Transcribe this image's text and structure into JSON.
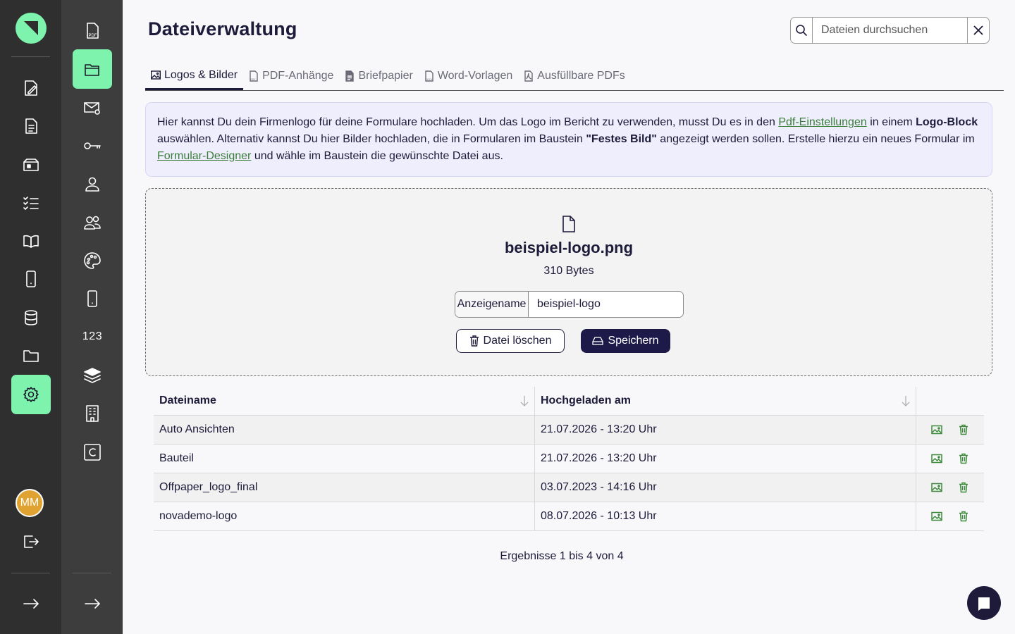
{
  "sidebar_primary": {
    "logo": "app-logo",
    "items": [
      {
        "name": "form-edit",
        "icon": "form-edit-icon"
      },
      {
        "name": "document",
        "icon": "document-icon"
      },
      {
        "name": "inbox",
        "icon": "inbox-icon"
      },
      {
        "name": "checklist",
        "icon": "checklist-icon"
      },
      {
        "name": "book",
        "icon": "book-icon"
      },
      {
        "name": "mobile",
        "icon": "mobile-icon"
      },
      {
        "name": "database",
        "icon": "database-icon"
      },
      {
        "name": "folder",
        "icon": "folder-icon"
      },
      {
        "name": "settings",
        "icon": "gear-icon",
        "active": true
      }
    ],
    "avatar_initials": "MM",
    "logout": "logout-icon",
    "expand": "arrow-right-icon"
  },
  "sidebar_secondary": {
    "items": [
      {
        "name": "pdf",
        "icon": "pdf-file-icon"
      },
      {
        "name": "files",
        "icon": "folder-open-icon",
        "active": true
      },
      {
        "name": "mail",
        "icon": "mail-at-icon"
      },
      {
        "name": "keys",
        "icon": "key-icon"
      },
      {
        "name": "user",
        "icon": "user-icon"
      },
      {
        "name": "users",
        "icon": "users-icon"
      },
      {
        "name": "palette",
        "icon": "palette-icon"
      },
      {
        "name": "device",
        "icon": "mobile-icon"
      },
      {
        "name": "numbers",
        "label": "123"
      },
      {
        "name": "layers",
        "icon": "layers-icon"
      },
      {
        "name": "building",
        "icon": "building-icon"
      },
      {
        "name": "copyright",
        "icon": "c-box-icon"
      }
    ],
    "expand": "arrow-right-icon"
  },
  "header": {
    "title": "Dateiverwaltung",
    "search_placeholder": "Dateien durchsuchen"
  },
  "tabs": [
    {
      "label": "Logos & Bilder",
      "icon": "image-icon",
      "active": true
    },
    {
      "label": "PDF-Anhänge",
      "icon": "pdf-file-icon"
    },
    {
      "label": "Briefpapier",
      "icon": "file-text-icon"
    },
    {
      "label": "Word-Vorlagen",
      "icon": "docx-file-icon"
    },
    {
      "label": "Ausfüllbare PDFs",
      "icon": "pdf-form-icon"
    }
  ],
  "info": {
    "t1": "Hier kannst Du dein Firmenlogo für deine Formulare hochladen. Um das Logo im Bericht zu verwenden, musst Du es in den ",
    "link1": "Pdf-Einstellungen",
    "t2": " in einem ",
    "bold1": "Logo-Block",
    "t3": " auswählen. Alternativ kannst Du hier Bilder hochladen, die in Formularen im Baustein ",
    "bold2": "\"Festes Bild\"",
    "t4": " angezeigt werden sollen. Erstelle hierzu ein neues Formular im ",
    "link2": "Formular-Designer",
    "t5": " und wähle im Baustein die gewünschte Datei aus."
  },
  "upload": {
    "file_name": "beispiel-logo.png",
    "file_size": "310 Bytes",
    "display_name_label": "Anzeigename",
    "display_name_value": "beispiel-logo",
    "delete_label": "Datei löschen",
    "save_label": "Speichern"
  },
  "table": {
    "columns": [
      "Dateiname",
      "Hochgeladen am"
    ],
    "rows": [
      {
        "name": "Auto Ansichten",
        "date": "21.07.2026 - 13:20 Uhr"
      },
      {
        "name": "Bauteil",
        "date": "21.07.2026 - 13:20 Uhr"
      },
      {
        "name": "Offpaper_logo_final",
        "date": "03.07.2023 - 14:16 Uhr"
      },
      {
        "name": "novademo-logo",
        "date": "08.07.2026 - 10:13 Uhr"
      }
    ],
    "results": "Ergebnisse 1 bis 4 von 4"
  },
  "colors": {
    "accent_green": "#7df3ad",
    "primary_dark": "#1d1a4a",
    "link_green": "#3b7d3b"
  }
}
